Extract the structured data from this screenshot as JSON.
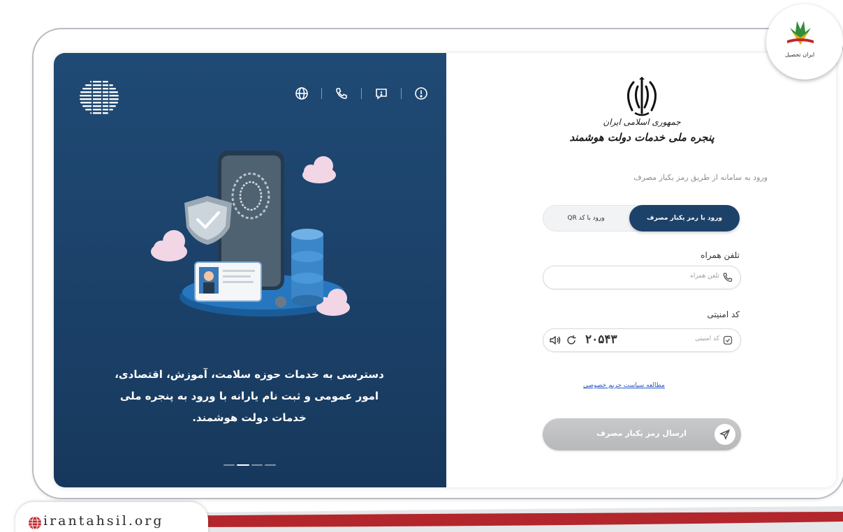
{
  "watermark": {
    "brand": "ایران تحصیل",
    "site": "irantahsil.org"
  },
  "left": {
    "top_icons": [
      "globe-icon",
      "phone-icon",
      "chat-icon",
      "info-icon"
    ],
    "promo_text": "دسترسی به خدمات حوزه سلامت، آموزش، اقتصادی، امور عمومی و ثبت نام یارانه با ورود به پنجره ملی خدمات دولت هوشمند.",
    "slides": 4,
    "active_slide": 2
  },
  "right": {
    "brand_line1": "جمهوری اسلامی ایران",
    "brand_line2": "پنجره ملی خدمات دولت هوشمند",
    "subtitle": "ورود به سامانه از طریق رمز یکبار مصرف",
    "tabs": {
      "otp": "ورود با رمز یکبار مصرف",
      "qr": "ورود با کد QR"
    },
    "phone": {
      "label": "تلفن همراه",
      "placeholder": "تلفن همراه"
    },
    "captcha": {
      "label": "کد امنیتی",
      "placeholder": "کد امنیتی",
      "code": "۲۰۵۴۳"
    },
    "privacy_link": "مطالعه سیاست حریم خصوصی",
    "send_button": "ارسال رمز یکبار مصرف"
  },
  "colors": {
    "panel": "#1f4a74",
    "accent": "#1d426a",
    "button_disabled": "#bfc0c2",
    "band": "#b3262c"
  }
}
